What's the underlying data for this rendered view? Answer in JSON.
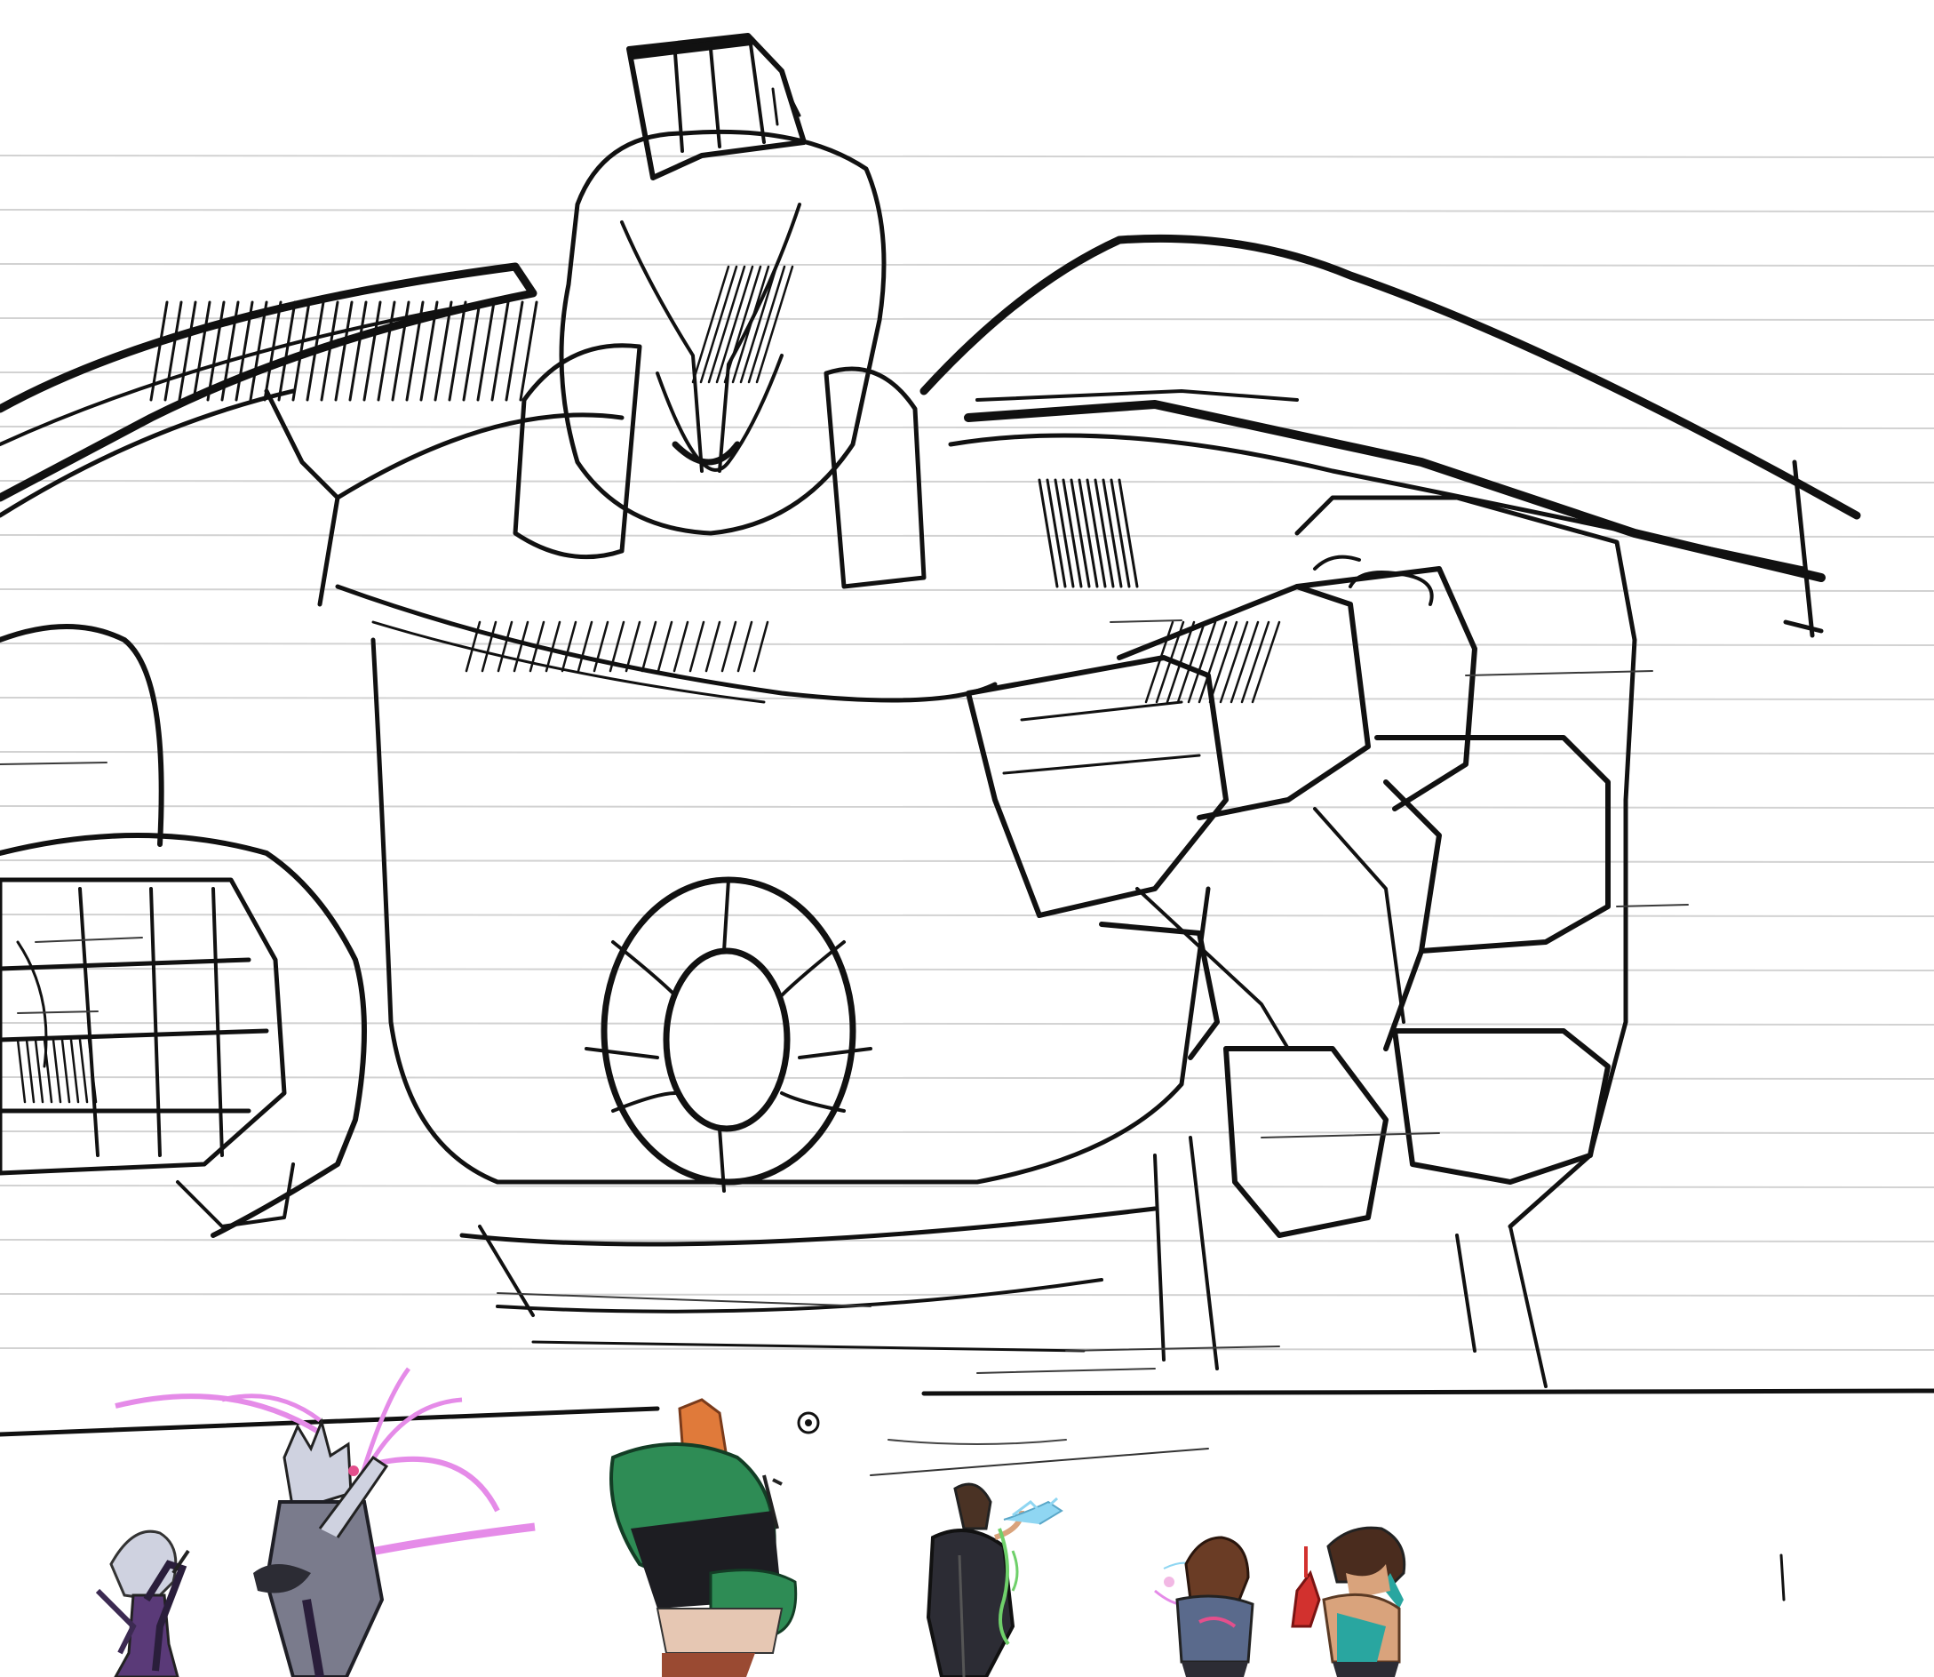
{
  "canvas": {
    "background": "#ffffff"
  },
  "artwork": {
    "palette": {
      "ink": "#111111",
      "paper": "#ffffff",
      "ruled_lines": "#d2d2d2",
      "magic": "#e58be8",
      "jacket_green": "#2e8c55",
      "hair_orange": "#e07a3a",
      "pants_rust": "#9a4a32",
      "dark_coat": "#2c2c34",
      "energy_cyan": "#8fd6f2",
      "energy_green": "#6fd06a",
      "purple_dress": "#5a3a78",
      "pink_accent": "#e44f8c",
      "red_weapon": "#d2312e",
      "teal": "#29a6a0",
      "skin": "#d9a37c",
      "brown_hair": "#6a3c25",
      "silver": "#cfd2e0"
    },
    "icons": [
      "target-reticle-icon"
    ]
  }
}
